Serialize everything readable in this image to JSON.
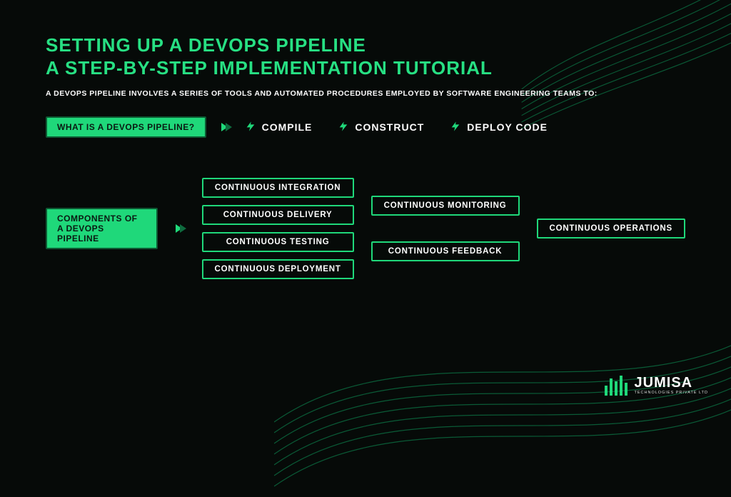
{
  "title_line1": "SETTING UP A DEVOPS PIPELINE",
  "title_line2": "A STEP-BY-STEP IMPLEMENTATION TUTORIAL",
  "intro": "A DEVOPS PIPELINE INVOLVES A SERIES OF TOOLS AND AUTOMATED PROCEDURES EMPLOYED BY SOFTWARE ENGINEERING TEAMS TO:",
  "q1_label": "WHAT IS A DEVOPS PIPELINE?",
  "actions": [
    "COMPILE",
    "CONSTRUCT",
    "DEPLOY CODE"
  ],
  "q2_label": "COMPONENTS OF A DEVOPS PIPELINE",
  "components_col1": [
    "CONTINUOUS INTEGRATION",
    "CONTINUOUS DELIVERY",
    "CONTINUOUS TESTING",
    "CONTINUOUS DEPLOYMENT"
  ],
  "components_col2": [
    "CONTINUOUS MONITORING",
    "CONTINUOUS FEEDBACK"
  ],
  "components_col3": [
    "CONTINUOUS OPERATIONS"
  ],
  "logo_name": "JUMISA",
  "logo_sub": "TECHNOLOGIES PRIVATE LTD"
}
